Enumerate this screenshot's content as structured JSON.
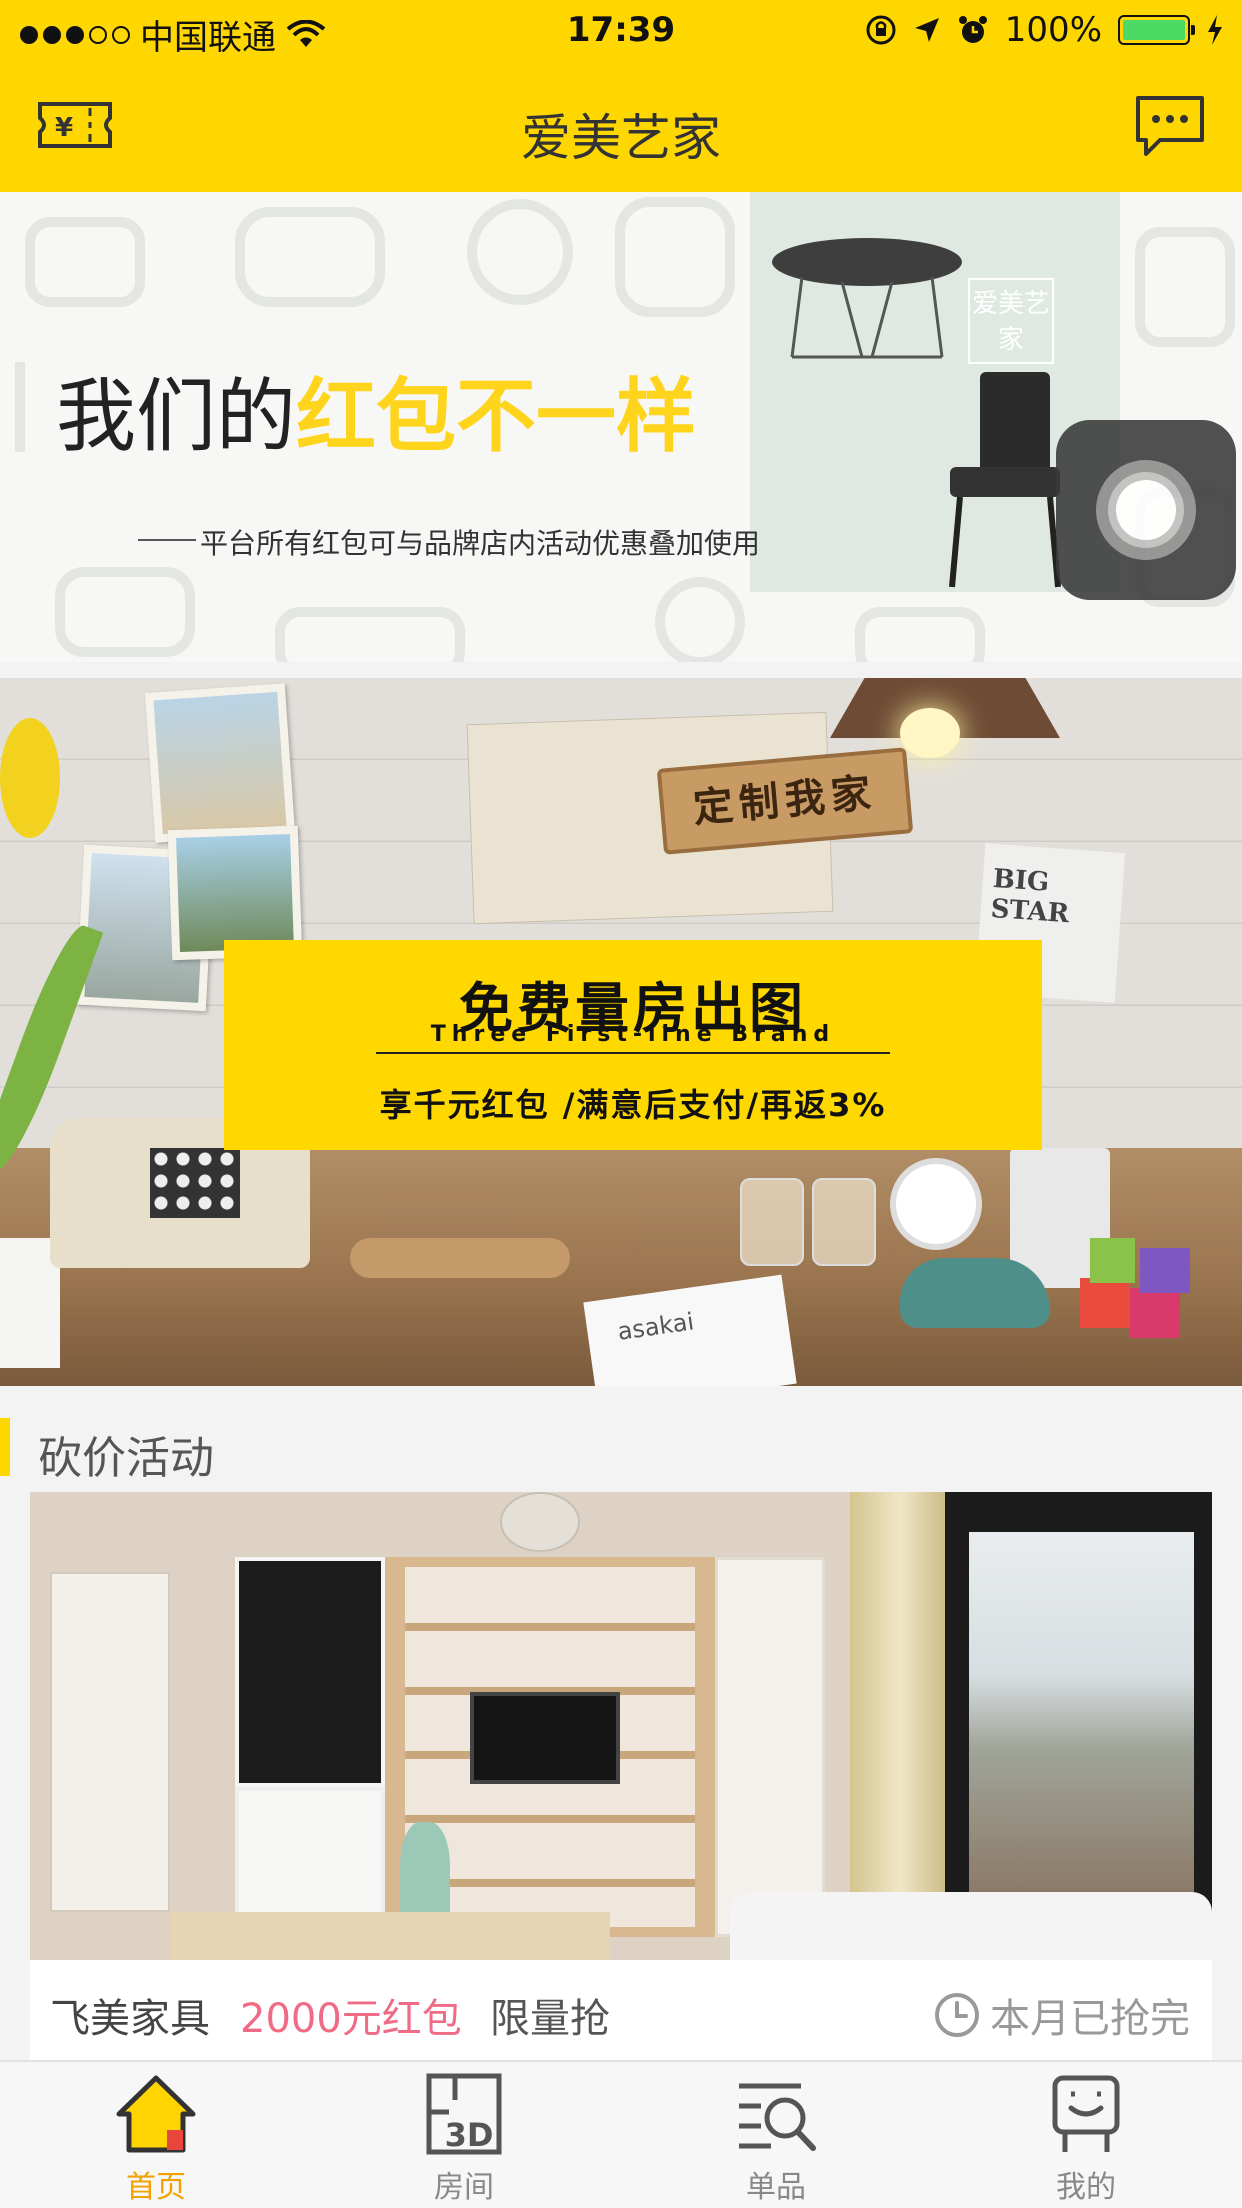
{
  "status_bar": {
    "carrier": "中国联通",
    "time": "17:39",
    "battery": "100%",
    "signal_bars_filled": 3,
    "signal_bars_total": 5
  },
  "header": {
    "title": "爱美艺家",
    "left_icon": "coupon-ticket-icon",
    "left_icon_text": "¥",
    "right_icon": "message-chat-icon"
  },
  "banner1": {
    "headline_plain": "我们的",
    "headline_highlight": "红包不一样",
    "subtitle": "平台所有红包可与品牌店内活动优惠叠加使用",
    "seal_text": "爱美艺家",
    "colors": {
      "highlight": "#ffd41c",
      "panel": "#dfe9e2"
    }
  },
  "banner2": {
    "sign_text": "定制我家",
    "title": "免费量房出图",
    "english": "Three First-line Brand",
    "subtitle": "享千元红包 /满意后支付/再返3%",
    "poster_text": "BIG STAR",
    "paper_text": "asakai",
    "colors": {
      "box": "#ffd800"
    }
  },
  "section": {
    "title": "砍价活动",
    "accent": "#ffd700"
  },
  "activity_card": {
    "brand": "飞美家具",
    "amount": "2000元红包",
    "limit": "限量抢",
    "status": "本月已抢完",
    "status_icon": "clock-icon",
    "colors": {
      "amount": "#f06b85"
    }
  },
  "assistive_touch": {
    "icon": "assistive-touch-icon"
  },
  "tabs": [
    {
      "label": "首页",
      "icon": "home-icon",
      "active": true
    },
    {
      "label": "房间",
      "icon": "room-3d-icon",
      "icon_text": "3D",
      "active": false
    },
    {
      "label": "单品",
      "icon": "product-search-icon",
      "active": false
    },
    {
      "label": "我的",
      "icon": "profile-icon",
      "active": false
    }
  ],
  "theme": {
    "primary": "#ffd700",
    "active_tab": "#f2a100"
  }
}
